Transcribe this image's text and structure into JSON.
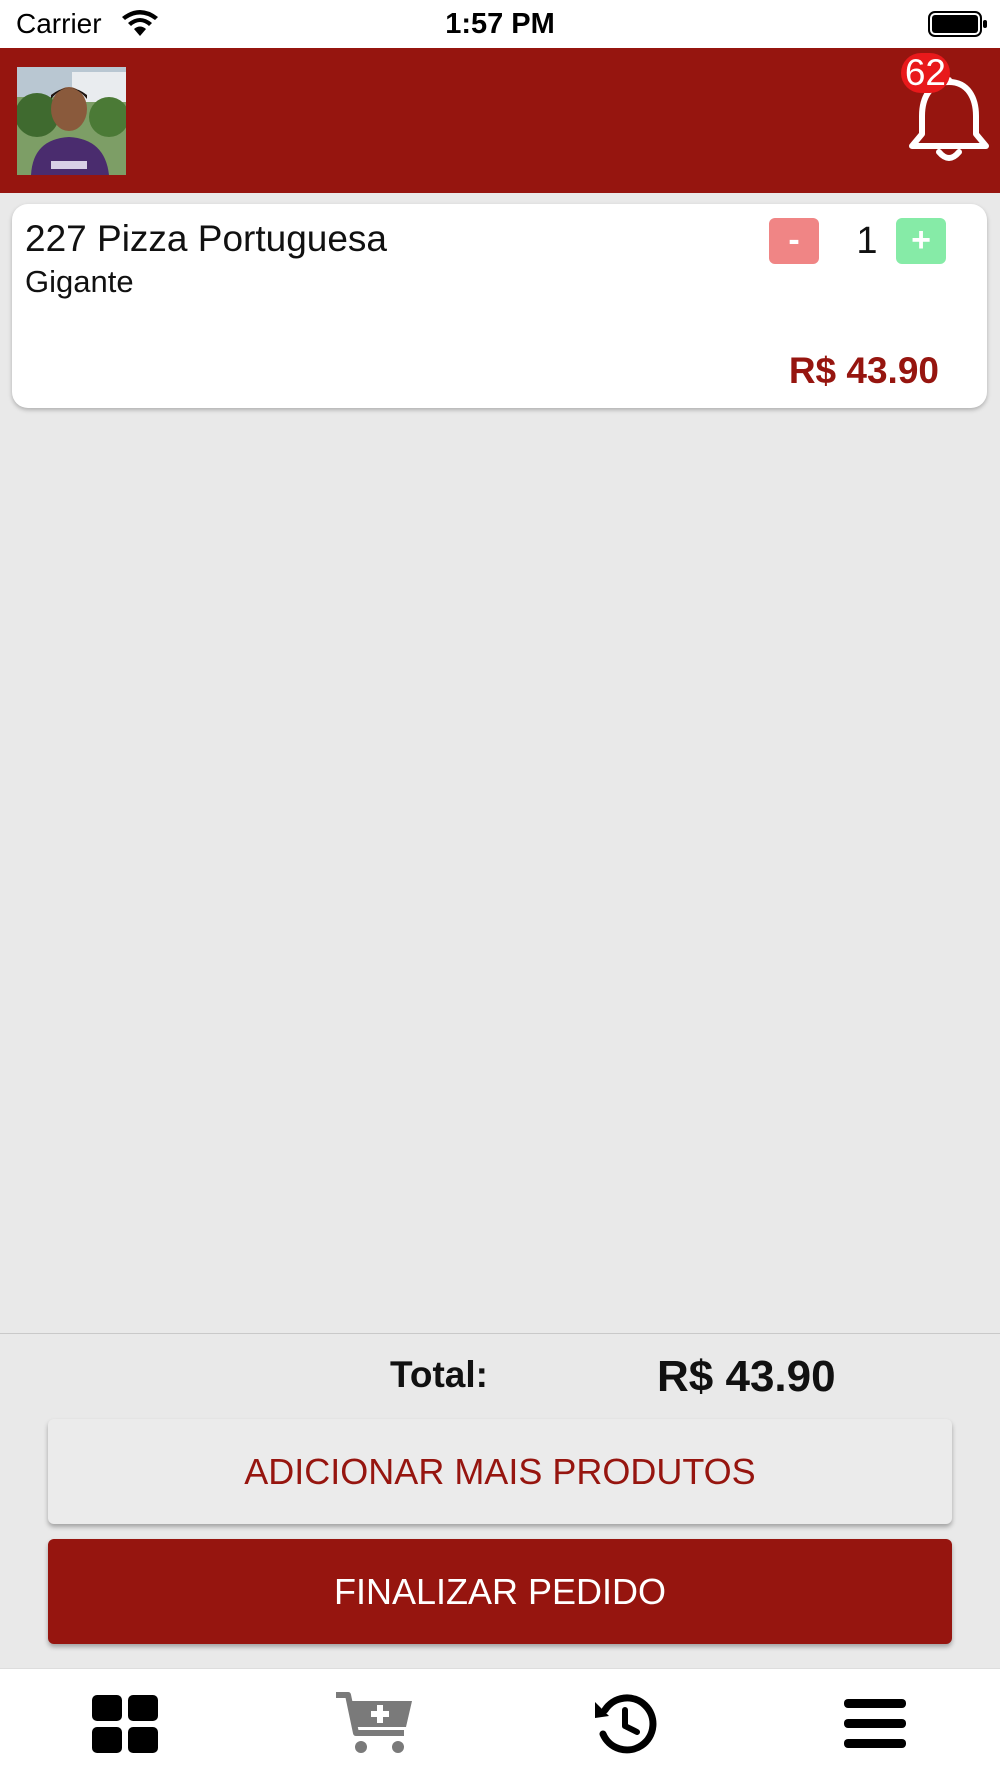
{
  "status_bar": {
    "carrier": "Carrier",
    "time": "1:57 PM"
  },
  "header": {
    "notification_count": "62",
    "colors": {
      "brand": "#96150f",
      "badge": "#e8191b"
    }
  },
  "cart": {
    "items": [
      {
        "name": "227 Pizza Portuguesa",
        "size": "Gigante",
        "quantity": "1",
        "minus_label": "-",
        "plus_label": "+",
        "price": "R$ 43.90"
      }
    ]
  },
  "summary": {
    "total_label": "Total:",
    "total_value": "R$ 43.90"
  },
  "actions": {
    "add_more": "ADICIONAR MAIS PRODUTOS",
    "finish": "FINALIZAR PEDIDO"
  },
  "tabbar": {
    "tabs": [
      {
        "icon": "grid-icon"
      },
      {
        "icon": "cart-add-icon"
      },
      {
        "icon": "history-icon"
      },
      {
        "icon": "menu-icon"
      }
    ]
  }
}
